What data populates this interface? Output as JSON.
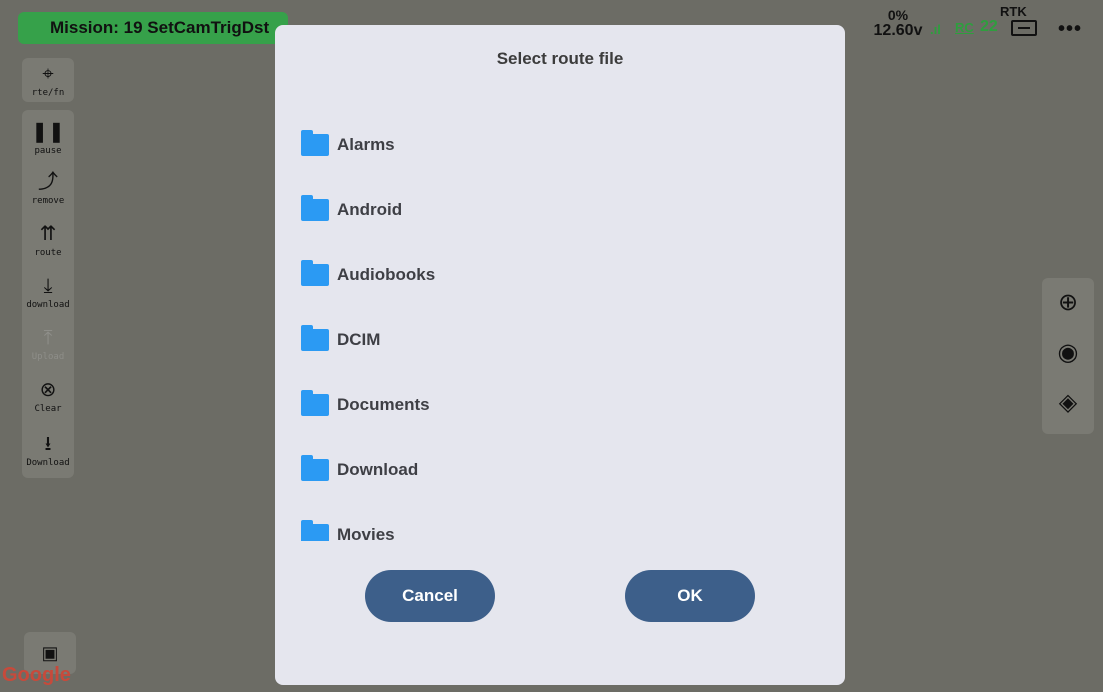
{
  "topbar": {
    "mission_label": "Mission: 19 SetCamTrigDst",
    "rtk_label": "RTK",
    "battery_percent": "0%",
    "battery_voltage": "12.60v",
    "rc_label": "RC",
    "rc_value": "22",
    "more_label": "•••"
  },
  "left_toolbar": {
    "top_item": {
      "label": "rte/fn",
      "icon": "route-function-icon"
    },
    "items": [
      {
        "label": "pause",
        "icon": "pause-icon",
        "enabled": true
      },
      {
        "label": "remove",
        "icon": "remove-route-icon",
        "enabled": true
      },
      {
        "label": "route",
        "icon": "route-icon",
        "enabled": true
      },
      {
        "label": "download",
        "icon": "download-icon",
        "enabled": true
      },
      {
        "label": "Upload",
        "icon": "upload-icon",
        "enabled": false
      },
      {
        "label": "Clear",
        "icon": "clear-icon",
        "enabled": true
      },
      {
        "label": "Download",
        "icon": "download-alt-icon",
        "enabled": true
      }
    ]
  },
  "map_controls": [
    {
      "icon": "compass-icon"
    },
    {
      "icon": "locate-icon"
    },
    {
      "icon": "layers-icon"
    }
  ],
  "google_label": "Google",
  "dialog": {
    "title": "Select route file",
    "files": [
      {
        "name": "Alarms",
        "type": "folder"
      },
      {
        "name": "Android",
        "type": "folder"
      },
      {
        "name": "Audiobooks",
        "type": "folder"
      },
      {
        "name": "DCIM",
        "type": "folder"
      },
      {
        "name": "Documents",
        "type": "folder"
      },
      {
        "name": "Download",
        "type": "folder"
      },
      {
        "name": "Movies",
        "type": "folder"
      }
    ],
    "cancel_label": "Cancel",
    "ok_label": "OK"
  },
  "colors": {
    "mission_bg": "#36a14a",
    "folder_blue": "#2b9af3",
    "button_blue": "#3d5f8a",
    "dialog_bg": "#e5e6ee",
    "status_green": "#2e9e3e"
  }
}
